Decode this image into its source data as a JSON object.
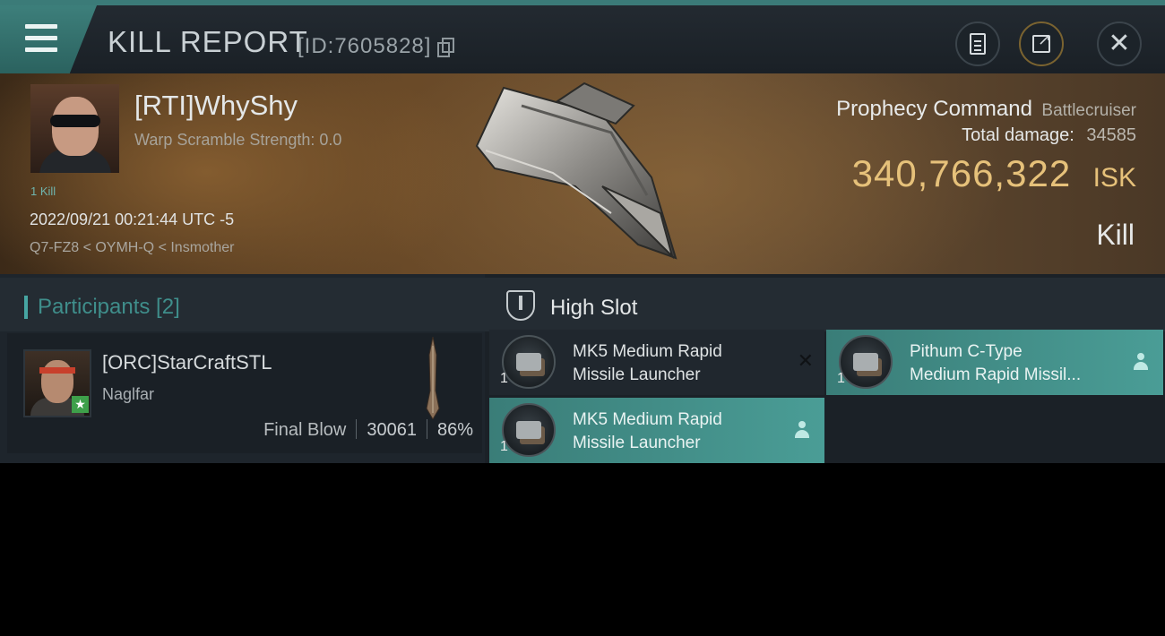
{
  "header": {
    "title": "KILL REPORT",
    "report_id": "[ID:7605828]",
    "close_glyph": "✕"
  },
  "victim": {
    "name": "[RTI]WhyShy",
    "warp_scramble": "Warp Scramble Strength: 0.0",
    "kill_count": "1 Kill",
    "timestamp": "2022/09/21 00:21:44 UTC -5",
    "location": "Q7-FZ8 < OYMH-Q < Insmother",
    "ship_name": "Prophecy Command",
    "ship_class": "Battlecruiser",
    "total_damage_label": "Total damage:",
    "total_damage": "34585",
    "isk_value": "340,766,322",
    "isk_unit": "ISK",
    "report_type": "Kill"
  },
  "participants": {
    "title": "Participants [2]",
    "rows": [
      {
        "name": "[ORC]StarCraftSTL",
        "ship": "Naglfar",
        "tag": "Final Blow",
        "damage": "30061",
        "percent": "86%",
        "badge": "★"
      }
    ]
  },
  "high_slot": {
    "title": "High Slot",
    "items": [
      {
        "name_line1": "MK5 Medium Rapid",
        "name_line2": "Missile Launcher",
        "qty": "1",
        "status": "destroyed",
        "status_glyph": "✕"
      },
      {
        "name_line1": "Pithum C-Type",
        "name_line2": "Medium Rapid Missil...",
        "qty": "1",
        "status": "dropped"
      },
      {
        "name_line1": "MK5 Medium Rapid",
        "name_line2": "Missile Launcher",
        "qty": "1",
        "status": "dropped"
      }
    ]
  },
  "colors": {
    "accent_teal": "#3a7d78",
    "isk_gold": "#e6c17a",
    "final_blow_badge": "#3ea04a"
  }
}
